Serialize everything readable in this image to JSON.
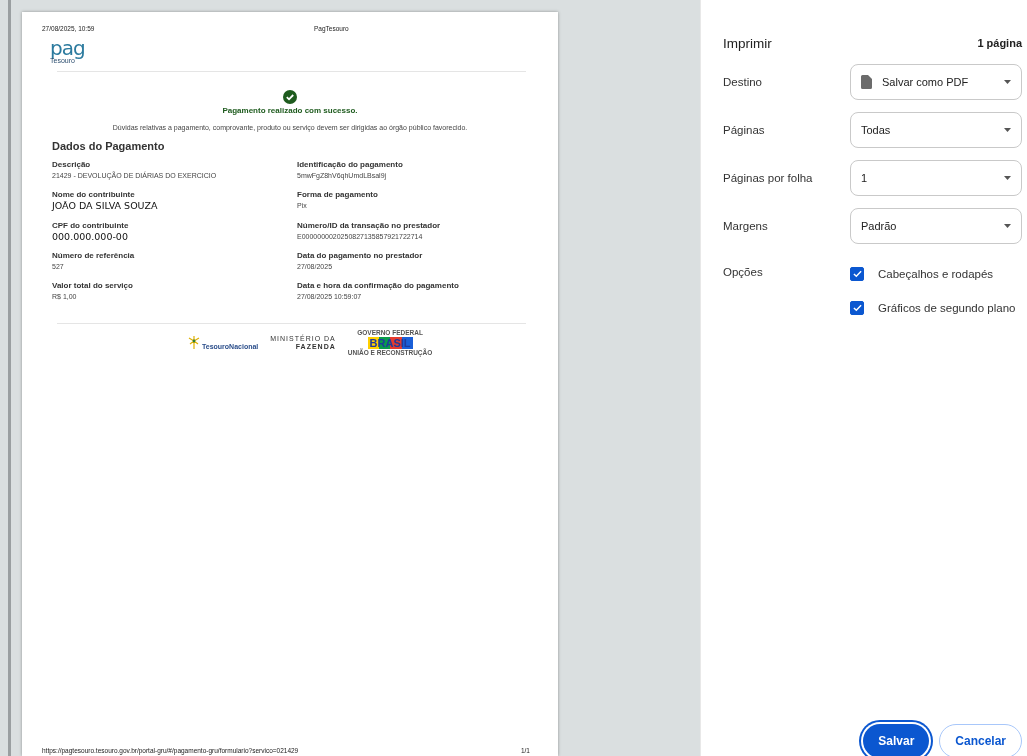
{
  "preview": {
    "header": {
      "date": "27/08/2025, 10:59",
      "title": "PagTesouro"
    },
    "logo": {
      "word": "pag",
      "sub": "Tesouro"
    },
    "status": {
      "message": "Pagamento realizado com sucesso.",
      "notice": "Dúvidas relativas a pagamento, comprovante, produto ou serviço devem ser dirigidas ao órgão público favorecido."
    },
    "section_title": "Dados do Pagamento",
    "columns": [
      [
        {
          "label": "Descrição",
          "value": "21429 - DEVOLUÇÃO DE DIÁRIAS DO EXERCICIO",
          "kind": "plain"
        },
        {
          "label": "Nome do contribuinte",
          "value": "JOÃO DA SILVA SOUZA",
          "kind": "large"
        },
        {
          "label": "CPF do contribuinte",
          "value": "000.000.000-00",
          "kind": "large"
        },
        {
          "label": "Número de referência",
          "value": "527",
          "kind": "plain"
        },
        {
          "label": "Valor total do serviço",
          "value": "R$  1,00",
          "kind": "plain"
        }
      ],
      [
        {
          "label": "Identificação do pagamento",
          "value": "5mwFgZ8hV6qhUmdLBsal9j",
          "kind": "plain"
        },
        {
          "label": "Forma de pagamento",
          "value": "Pix",
          "kind": "plain"
        },
        {
          "label": "Número/ID da transação no prestador",
          "value": "E0000000020250827135857921722714",
          "kind": "plain"
        },
        {
          "label": "Data do pagamento no prestador",
          "value": "27/08/2025",
          "kind": "plain"
        },
        {
          "label": "Data e hora da confirmação do pagamento",
          "value": "27/08/2025 10:59:07",
          "kind": "plain"
        }
      ]
    ],
    "footer_logos": {
      "tesouro": "TesouroNacional",
      "ministry_top": "MINISTÉRIO DA",
      "ministry_bottom": "FAZENDA",
      "gov_top": "GOVERNO FEDERAL",
      "gov_main": "BRASIL",
      "gov_bottom": "UNIÃO E RECONSTRUÇÃO"
    },
    "page_footer": {
      "url": "https://pagtesouro.tesouro.gov.br/portal-gru/#/pagamento-gru/formulario?servico=021429",
      "page": "1/1"
    }
  },
  "print_panel": {
    "title": "Imprimir",
    "page_count": "1 página",
    "settings": [
      {
        "label": "Destino",
        "value": "Salvar como PDF",
        "kind": "destination"
      },
      {
        "label": "Páginas",
        "value": "Todas",
        "kind": "select"
      },
      {
        "label": "Páginas por folha",
        "value": "1",
        "kind": "select"
      },
      {
        "label": "Margens",
        "value": "Padrão",
        "kind": "select"
      }
    ],
    "options": {
      "label": "Opções",
      "items": [
        {
          "label": "Cabeçalhos e rodapés",
          "checked": true
        },
        {
          "label": "Gráficos de segundo plano",
          "checked": true
        }
      ]
    },
    "buttons": [
      {
        "label": "Salvar",
        "kind": "primary"
      },
      {
        "label": "Cancelar",
        "kind": "secondary"
      }
    ]
  }
}
